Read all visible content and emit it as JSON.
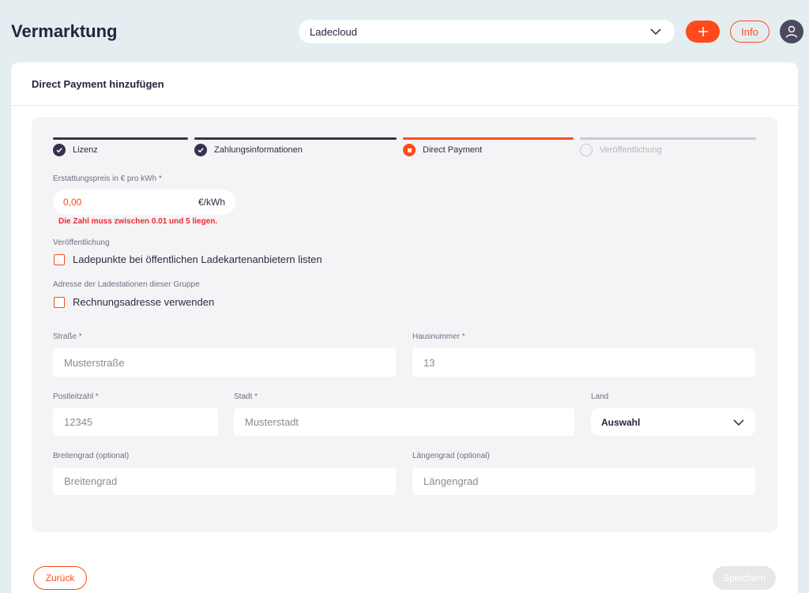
{
  "header": {
    "title": "Vermarktung",
    "org_select": "Ladecloud",
    "info_label": "Info"
  },
  "card": {
    "title": "Direct Payment hinzufügen"
  },
  "steps": [
    {
      "label": "Lizenz",
      "state": "done"
    },
    {
      "label": "Zahlungsinformationen",
      "state": "done"
    },
    {
      "label": "Direct Payment",
      "state": "active"
    },
    {
      "label": "Veröffentlichung",
      "state": "todo"
    }
  ],
  "price": {
    "label": "Erstattungspreis in € pro kWh *",
    "value": "0,00",
    "unit": "€/kWh",
    "error": "Die Zahl muss zwischen 0.01 und 5 liegen."
  },
  "publication": {
    "label": "Veröffentlichung",
    "checkbox_label": "Ladepunkte bei öffentlichen Ladekartenanbietern listen"
  },
  "address_section": {
    "label": "Adresse der Ladestationen dieser Gruppe",
    "checkbox_label": "Rechnungsadresse verwenden"
  },
  "fields": {
    "street": {
      "label": "Straße *",
      "placeholder": "Musterstraße"
    },
    "house_number": {
      "label": "Hausnummer *",
      "placeholder": "13"
    },
    "postal_code": {
      "label": "Postleitzahl *",
      "placeholder": "12345"
    },
    "city": {
      "label": "Stadt *",
      "placeholder": "Musterstadt"
    },
    "country": {
      "label": "Land",
      "value": "Auswahl"
    },
    "latitude": {
      "label": "Breitengrad (optional)",
      "placeholder": "Breitengrad"
    },
    "longitude": {
      "label": "Längengrad (optional)",
      "placeholder": "Längengrad"
    }
  },
  "footer": {
    "back_label": "Zurück",
    "save_label": "Speichern"
  },
  "colors": {
    "accent": "#ff4a1c",
    "error": "#ee2a35",
    "done": "#34334d",
    "inactive": "#c9c9d0"
  }
}
